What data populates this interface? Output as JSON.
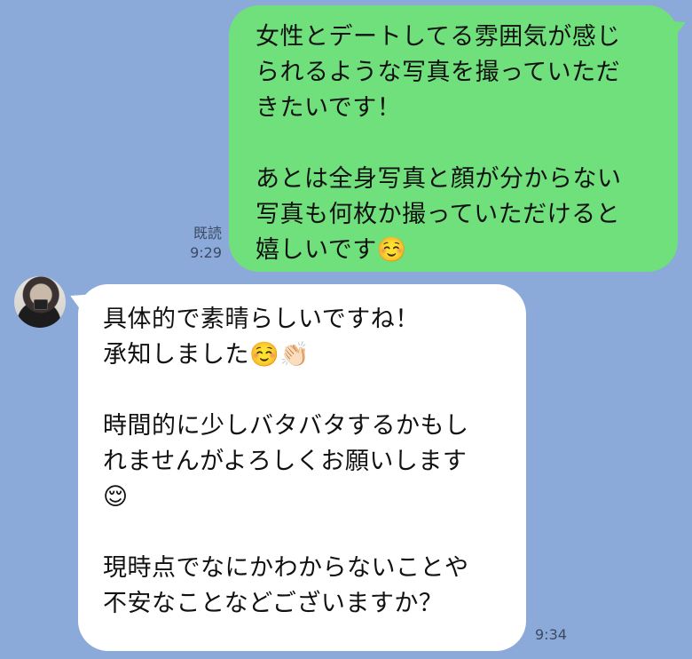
{
  "colors": {
    "background": "#8caad9",
    "sent_bubble": "#6fe07b",
    "received_bubble": "#ffffff",
    "meta_text": "#3b4a63"
  },
  "messages": {
    "sent": {
      "lines": [
        "女性とデートしてる雰囲気が感じ",
        "られるような写真を撮っていただ",
        "きたいです！",
        "",
        "あとは全身写真と顔が分からない",
        "写真も何枚か撮っていただけると",
        "嬉しいです☺️"
      ],
      "read_label": "既読",
      "time": "9:29"
    },
    "received": {
      "avatar_icon": "user-avatar-photo",
      "lines": [
        "具体的で素晴らしいですね！",
        "承知しました☺️👏🏻",
        "",
        "時間的に少しバタバタするかもし",
        "れませんがよろしくお願いします",
        "😌",
        "",
        "現時点でなにかわからないことや",
        "不安なことなどございますか？"
      ],
      "time": "9:34"
    }
  }
}
